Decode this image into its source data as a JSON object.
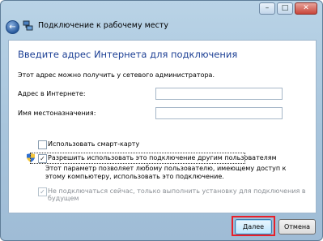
{
  "window": {
    "title": "Подключение к рабочему месту",
    "caption_buttons": {
      "minimize": "–",
      "maximize": "□",
      "close": "✕"
    },
    "back_glyph": "←"
  },
  "content": {
    "heading": "Введите адрес Интернета для подключения",
    "description": "Этот адрес можно получить у сетевого администратора.",
    "fields": {
      "internet_address": {
        "label": "Адрес в Интернете:",
        "value": ""
      },
      "destination_name": {
        "label": "Имя местоназначения:",
        "value": ""
      }
    },
    "checkboxes": {
      "smart_card": {
        "label": "Использовать смарт-карту",
        "checked": false,
        "enabled": true
      },
      "allow_others": {
        "label": "Разрешить использовать это подключение другим пользователям",
        "checked": true,
        "enabled": true
      },
      "dont_connect": {
        "label": "Не подключаться сейчас, только выполнить установку для подключения в будущем",
        "checked": true,
        "enabled": false
      }
    },
    "allow_others_explanation": "Этот параметр позволяет любому пользователю, имеющему доступ к этому компьютеру, использовать это подключение.",
    "check_glyph": "✓"
  },
  "buttons": {
    "next": "Далее",
    "cancel": "Отмена"
  },
  "colors": {
    "heading": "#1c3f94",
    "highlight": "#e8202a"
  },
  "icons": {
    "back": "back-arrow-icon",
    "title": "network-icon",
    "uac": "uac-shield-icon"
  }
}
